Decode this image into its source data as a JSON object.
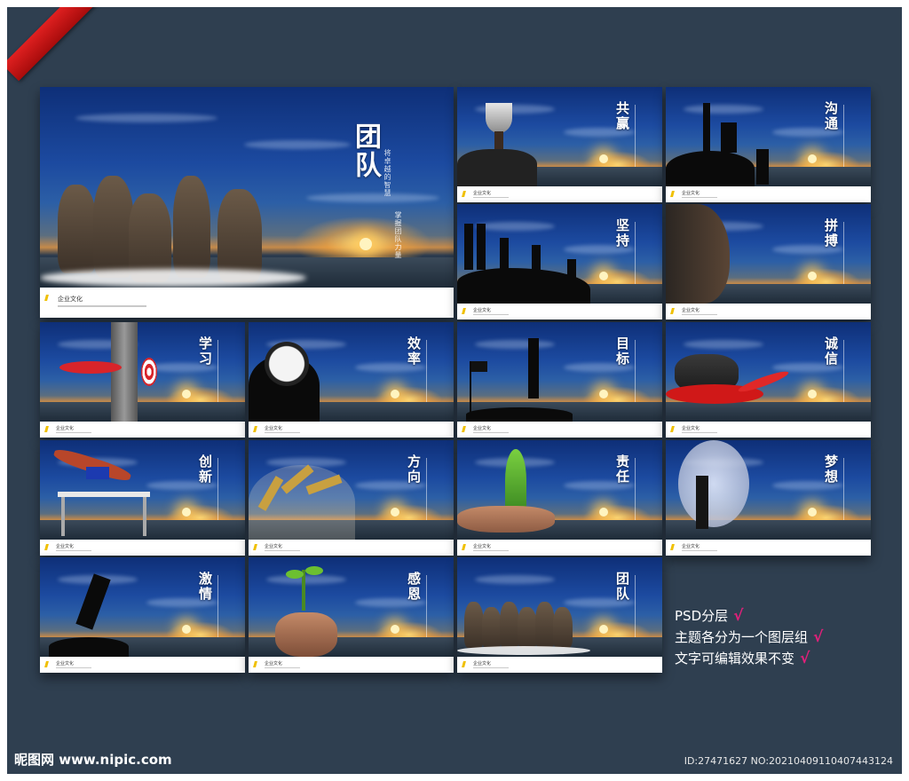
{
  "colors": {
    "background": "#2f3f50",
    "check": "#e0207a",
    "ribbon": "#d01818"
  },
  "cover": {
    "title": "团队",
    "subtitle_a": "将卓越的智慧",
    "subtitle_b": "掌握团队力量",
    "footer_label": "企业文化"
  },
  "panels": [
    {
      "title": "共赢",
      "scene": "trophy-hands"
    },
    {
      "title": "沟通",
      "scene": "climbers-rock"
    },
    {
      "title": "坚持",
      "scene": "team-pulling"
    },
    {
      "title": "拼搏",
      "scene": "rock-climber"
    },
    {
      "title": "学习",
      "scene": "dart-target"
    },
    {
      "title": "效率",
      "scene": "clock-man"
    },
    {
      "title": "目标",
      "scene": "flag-runner"
    },
    {
      "title": "诚信",
      "scene": "tripod-red-silk"
    },
    {
      "title": "创新",
      "scene": "hurdler"
    },
    {
      "title": "方向",
      "scene": "compass-wheat"
    },
    {
      "title": "责任",
      "scene": "arrow-tree-hands"
    },
    {
      "title": "梦想",
      "scene": "businessman-moon"
    },
    {
      "title": "激情",
      "scene": "leaping-man"
    },
    {
      "title": "感恩",
      "scene": "sprout-hands"
    },
    {
      "title": "团队",
      "scene": "wolves"
    }
  ],
  "panel_footer_label": "企业文化",
  "notes": [
    {
      "text": "PSD分层",
      "check": "√"
    },
    {
      "text": "主题各分为一个图层组",
      "check": "√"
    },
    {
      "text": "文字可编辑效果不变",
      "check": "√"
    }
  ],
  "watermark": {
    "site": "昵图网 www.nipic.com",
    "id": "ID:27471627 NO:20210409110407443124"
  }
}
